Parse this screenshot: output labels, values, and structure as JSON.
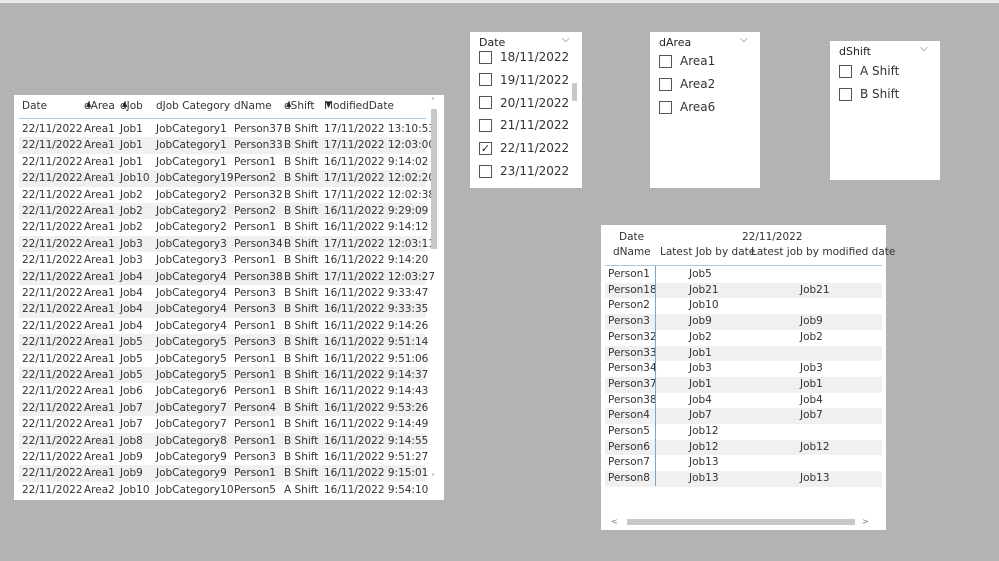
{
  "table": {
    "columns": [
      "Date",
      "dArea",
      "dJob",
      "dJob Category",
      "dName",
      "dShift",
      "ModifiedDate"
    ],
    "sort_indicators": {
      "dArea": "asc",
      "dJob": "asc",
      "dShift": "asc",
      "ModifiedDate": "desc"
    },
    "rows": [
      [
        "22/11/2022",
        "Area1",
        "Job1",
        "JobCategory1",
        "Person37",
        "B Shift",
        "17/11/2022 13:10:53"
      ],
      [
        "22/11/2022",
        "Area1",
        "Job1",
        "JobCategory1",
        "Person33",
        "B Shift",
        "17/11/2022 12:03:00"
      ],
      [
        "22/11/2022",
        "Area1",
        "Job1",
        "JobCategory1",
        "Person1",
        "B Shift",
        "16/11/2022 9:14:02"
      ],
      [
        "22/11/2022",
        "Area1",
        "Job10",
        "JobCategory19",
        "Person2",
        "B Shift",
        "17/11/2022 12:02:20"
      ],
      [
        "22/11/2022",
        "Area1",
        "Job2",
        "JobCategory2",
        "Person32",
        "B Shift",
        "17/11/2022 12:02:38"
      ],
      [
        "22/11/2022",
        "Area1",
        "Job2",
        "JobCategory2",
        "Person2",
        "B Shift",
        "16/11/2022 9:29:09"
      ],
      [
        "22/11/2022",
        "Area1",
        "Job2",
        "JobCategory2",
        "Person1",
        "B Shift",
        "16/11/2022 9:14:12"
      ],
      [
        "22/11/2022",
        "Area1",
        "Job3",
        "JobCategory3",
        "Person34",
        "B Shift",
        "17/11/2022 12:03:11"
      ],
      [
        "22/11/2022",
        "Area1",
        "Job3",
        "JobCategory3",
        "Person1",
        "B Shift",
        "16/11/2022 9:14:20"
      ],
      [
        "22/11/2022",
        "Area1",
        "Job4",
        "JobCategory4",
        "Person38",
        "B Shift",
        "17/11/2022 12:03:27"
      ],
      [
        "22/11/2022",
        "Area1",
        "Job4",
        "JobCategory4",
        "Person3",
        "B Shift",
        "16/11/2022 9:33:47"
      ],
      [
        "22/11/2022",
        "Area1",
        "Job4",
        "JobCategory4",
        "Person3",
        "B Shift",
        "16/11/2022 9:33:35"
      ],
      [
        "22/11/2022",
        "Area1",
        "Job4",
        "JobCategory4",
        "Person1",
        "B Shift",
        "16/11/2022 9:14:26"
      ],
      [
        "22/11/2022",
        "Area1",
        "Job5",
        "JobCategory5",
        "Person3",
        "B Shift",
        "16/11/2022 9:51:14"
      ],
      [
        "22/11/2022",
        "Area1",
        "Job5",
        "JobCategory5",
        "Person1",
        "B Shift",
        "16/11/2022 9:51:06"
      ],
      [
        "22/11/2022",
        "Area1",
        "Job5",
        "JobCategory5",
        "Person1",
        "B Shift",
        "16/11/2022 9:14:37"
      ],
      [
        "22/11/2022",
        "Area1",
        "Job6",
        "JobCategory6",
        "Person1",
        "B Shift",
        "16/11/2022 9:14:43"
      ],
      [
        "22/11/2022",
        "Area1",
        "Job7",
        "JobCategory7",
        "Person4",
        "B Shift",
        "16/11/2022 9:53:26"
      ],
      [
        "22/11/2022",
        "Area1",
        "Job7",
        "JobCategory7",
        "Person1",
        "B Shift",
        "16/11/2022 9:14:49"
      ],
      [
        "22/11/2022",
        "Area1",
        "Job8",
        "JobCategory8",
        "Person1",
        "B Shift",
        "16/11/2022 9:14:55"
      ],
      [
        "22/11/2022",
        "Area1",
        "Job9",
        "JobCategory9",
        "Person3",
        "B Shift",
        "16/11/2022 9:51:27"
      ],
      [
        "22/11/2022",
        "Area1",
        "Job9",
        "JobCategory9",
        "Person1",
        "B Shift",
        "16/11/2022 9:15:01"
      ],
      [
        "22/11/2022",
        "Area2",
        "Job10",
        "JobCategory10",
        "Person5",
        "A Shift",
        "16/11/2022 9:54:10"
      ]
    ]
  },
  "slicers": {
    "date": {
      "title": "Date",
      "items": [
        {
          "label": "18/11/2022",
          "checked": false
        },
        {
          "label": "19/11/2022",
          "checked": false
        },
        {
          "label": "20/11/2022",
          "checked": false
        },
        {
          "label": "21/11/2022",
          "checked": false
        },
        {
          "label": "22/11/2022",
          "checked": true
        },
        {
          "label": "23/11/2022",
          "checked": false
        }
      ]
    },
    "darea": {
      "title": "dArea",
      "items": [
        {
          "label": "Area1",
          "checked": false
        },
        {
          "label": "Area2",
          "checked": false
        },
        {
          "label": "Area6",
          "checked": false
        }
      ]
    },
    "dshift": {
      "title": "dShift",
      "items": [
        {
          "label": "A Shift",
          "checked": false
        },
        {
          "label": "B Shift",
          "checked": false
        }
      ]
    }
  },
  "matrix": {
    "row_header_1": "Date",
    "row_header_2": "dName",
    "date_value": "22/11/2022",
    "col1": "Latest Job by date",
    "col2": "Latest job by modified date",
    "rows": [
      [
        "Person1",
        "Job5",
        ""
      ],
      [
        "Person18",
        "Job21",
        "Job21"
      ],
      [
        "Person2",
        "Job10",
        ""
      ],
      [
        "Person3",
        "Job9",
        "Job9"
      ],
      [
        "Person32",
        "Job2",
        "Job2"
      ],
      [
        "Person33",
        "Job1",
        ""
      ],
      [
        "Person34",
        "Job3",
        "Job3"
      ],
      [
        "Person37",
        "Job1",
        "Job1"
      ],
      [
        "Person38",
        "Job4",
        "Job4"
      ],
      [
        "Person4",
        "Job7",
        "Job7"
      ],
      [
        "Person5",
        "Job12",
        ""
      ],
      [
        "Person6",
        "Job12",
        "Job12"
      ],
      [
        "Person7",
        "Job13",
        ""
      ],
      [
        "Person8",
        "Job13",
        "Job13"
      ]
    ]
  },
  "colors": {
    "background": "#b3b3b3",
    "alt_row": "#f0f0f0",
    "header_line": "#a9c7dc"
  }
}
